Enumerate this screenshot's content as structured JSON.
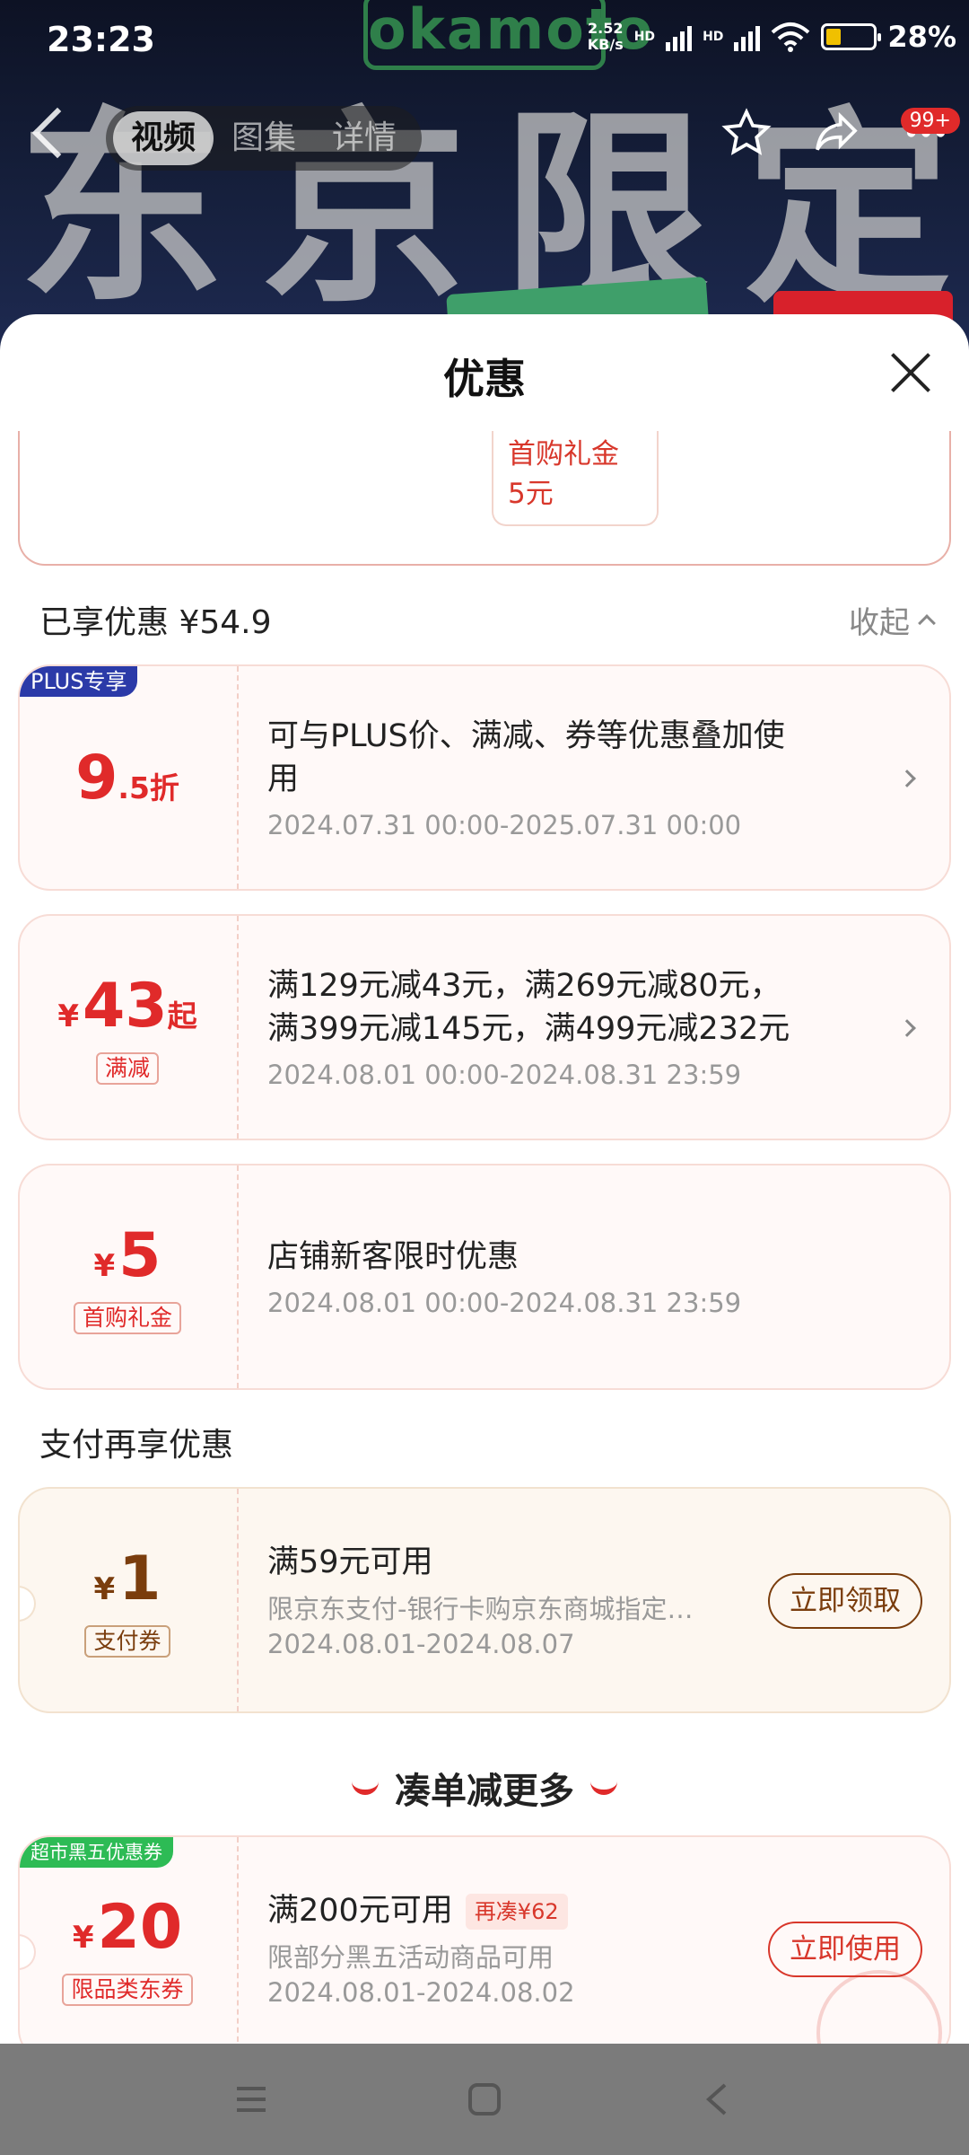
{
  "status": {
    "time": "23:23",
    "speed_top": "2.52",
    "speed_bottom": "KB/s",
    "hd1": "HD",
    "hd2": "HD",
    "battery": "28%"
  },
  "background": {
    "brand": "okamoto",
    "banner_chars": [
      "东",
      "京",
      "限",
      "定"
    ],
    "badge": "99+"
  },
  "nav": {
    "tabs": [
      "视频",
      "图集",
      "详情"
    ],
    "active_tab": 0
  },
  "sheet": {
    "title": "优惠",
    "top_gift": {
      "line1": "首购礼金",
      "line2": "5元"
    },
    "enjoyed_label": "已享优惠 ¥54.9",
    "collapse_label": "收起",
    "offers": [
      {
        "corner_tag": "PLUS专享",
        "amount_num": "9",
        "amount_suffix": ".5折",
        "text": "可与PLUS价、满减、券等优惠叠加使用",
        "date": "2024.07.31 00:00-2025.07.31 00:00"
      },
      {
        "amount_cur": "¥",
        "amount_num": "43",
        "amount_suffix": "起",
        "tag": "满减",
        "text_line1": "满129元减43元，满269元减80元，",
        "text_line2": "满399元减145元，满499元减232元",
        "date": "2024.08.01 00:00-2024.08.31 23:59"
      },
      {
        "amount_cur": "¥",
        "amount_num": "5",
        "tag": "首购礼金",
        "text": "店铺新客限时优惠",
        "date": "2024.08.01 00:00-2024.08.31 23:59"
      }
    ],
    "pay_section_title": "支付再享优惠",
    "pay_coupon": {
      "amount_cur": "¥",
      "amount_num": "1",
      "tag": "支付券",
      "text": "满59元可用",
      "sub": "限京东支付-银行卡购京东商城指定…",
      "date": "2024.08.01-2024.08.07",
      "button": "立即领取"
    },
    "more_title": "凑单减更多",
    "more_coupon": {
      "corner_tag": "超市黑五优惠券",
      "amount_cur": "¥",
      "amount_num": "20",
      "tag": "限品类东券",
      "text": "满200元可用",
      "badge": "再凑¥62",
      "sub": "限部分黑五活动商品可用",
      "date": "2024.08.01-2024.08.02",
      "button": "立即使用"
    }
  },
  "colors": {
    "accent_red": "#e02a2a",
    "plus_blue": "#2b3aa8",
    "pay_brown": "#7a3d0d",
    "tag_green": "#2dbb55"
  }
}
